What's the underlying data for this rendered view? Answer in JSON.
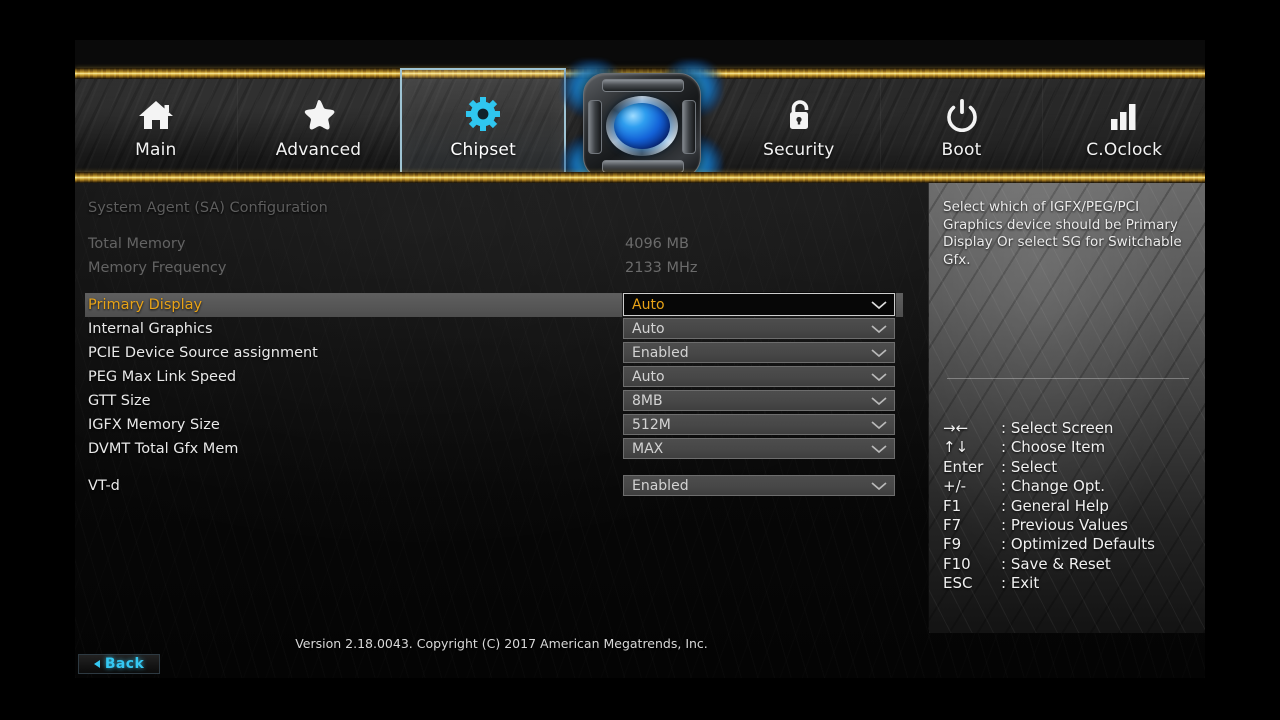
{
  "nav": {
    "tabs": [
      {
        "label": "Main",
        "icon": "home-icon",
        "active": false
      },
      {
        "label": "Advanced",
        "icon": "star-icon",
        "active": false
      },
      {
        "label": "Chipset",
        "icon": "gear-icon",
        "active": true
      },
      {
        "label": "Security",
        "icon": "lock-icon",
        "active": false
      },
      {
        "label": "Boot",
        "icon": "power-icon",
        "active": false
      },
      {
        "label": "C.Oclock",
        "icon": "bar-chart-icon",
        "active": false
      }
    ],
    "logo_icon": "motherboard-emblem-logo"
  },
  "settings": {
    "section_title": "System Agent (SA) Configuration",
    "info_rows": [
      {
        "label": "Total Memory",
        "value": "4096 MB"
      },
      {
        "label": "Memory Frequency",
        "value": "2133 MHz"
      }
    ],
    "options": [
      {
        "label": "Primary Display",
        "value": "Auto",
        "selected": true,
        "gap_before": false
      },
      {
        "label": "Internal Graphics",
        "value": "Auto",
        "selected": false,
        "gap_before": false
      },
      {
        "label": "PCIE Device Source assignment",
        "value": "Enabled",
        "selected": false,
        "gap_before": false
      },
      {
        "label": "PEG Max Link Speed",
        "value": "Auto",
        "selected": false,
        "gap_before": false
      },
      {
        "label": "GTT Size",
        "value": "8MB",
        "selected": false,
        "gap_before": false
      },
      {
        "label": "IGFX Memory Size",
        "value": "512M",
        "selected": false,
        "gap_before": false
      },
      {
        "label": "DVMT Total Gfx Mem",
        "value": "MAX",
        "selected": false,
        "gap_before": false
      },
      {
        "label": "VT-d",
        "value": "Enabled",
        "selected": false,
        "gap_before": true
      }
    ]
  },
  "help": {
    "text": "Select which of IGFX/PEG/PCI Graphics device should be Primary Display Or select SG for Switchable Gfx.",
    "keys": [
      {
        "key": "→←",
        "desc": ": Select Screen"
      },
      {
        "key": "↑↓",
        "desc": ": Choose Item"
      },
      {
        "key": "Enter",
        "desc": ": Select"
      },
      {
        "key": "+/-",
        "desc": ": Change Opt."
      },
      {
        "key": "F1",
        "desc": ": General Help"
      },
      {
        "key": "F7",
        "desc": ": Previous Values"
      },
      {
        "key": "F9",
        "desc": ": Optimized Defaults"
      },
      {
        "key": "F10",
        "desc": ": Save & Reset"
      },
      {
        "key": "ESC",
        "desc": ": Exit"
      }
    ]
  },
  "footer": {
    "version": "Version 2.18.0043. Copyright (C) 2017 American Megatrends, Inc.",
    "back_label": "Back"
  },
  "colors": {
    "accent_gold": "#e8a317",
    "accent_cyan": "#35c8f2",
    "rail_gold": "#d6ad3c",
    "active_tab_border": "#9fc4d4"
  }
}
